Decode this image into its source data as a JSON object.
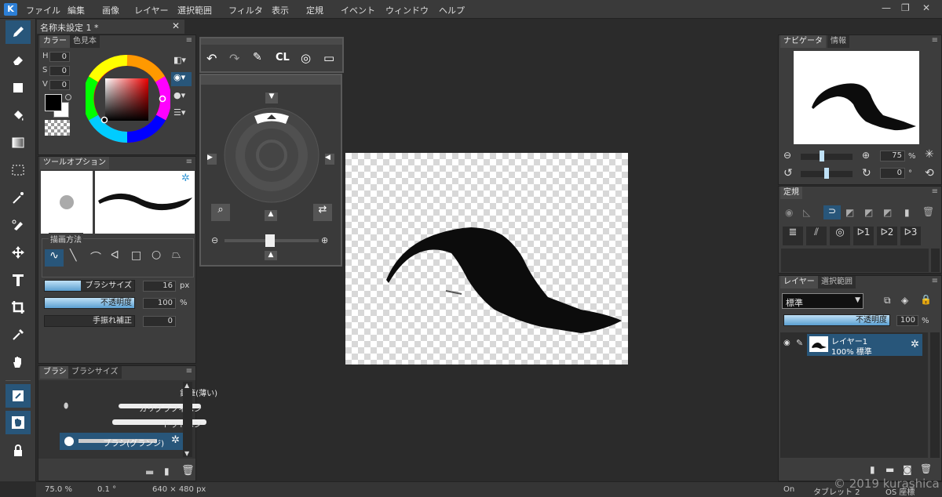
{
  "menubar": {
    "items": [
      "ファイル",
      "編集",
      "画像",
      "レイヤー",
      "選択範囲",
      "フィルタ",
      "表示",
      "定規",
      "イベント",
      "ウィンドウ",
      "ヘルプ"
    ]
  },
  "document_tab": {
    "title": "名称未設定 1 *"
  },
  "color_panel": {
    "tabs": [
      "カラー",
      "色見本"
    ],
    "h_label": "H",
    "s_label": "S",
    "v_label": "V",
    "h": "0",
    "s": "0",
    "v": "0",
    "foreground": "#000000",
    "background": "#ffffff"
  },
  "tool_options": {
    "tab": "ツールオプション",
    "draw_method_label": "描画方法",
    "brush_size_label": "ブラシサイズ",
    "brush_size": "16",
    "brush_size_unit": "px",
    "opacity_label": "不透明度",
    "opacity": "100",
    "opacity_unit": "%",
    "stabilizer_label": "手振れ補正",
    "stabilizer": "0"
  },
  "brush_panel": {
    "tabs": [
      "ブラシ",
      "ブラシサイズ"
    ],
    "items": [
      "鉛筆(薄い)",
      "カリグラフィペン",
      "ドットペン",
      "ブラシ(グランジ)"
    ],
    "selected": 3
  },
  "navigator": {
    "tabs": [
      "ナビゲータ",
      "情報"
    ],
    "zoom": "75",
    "zoom_unit": "%",
    "rotation": "0",
    "rotation_unit": "°"
  },
  "ruler_panel": {
    "tab": "定規"
  },
  "layer_panel": {
    "tabs": [
      "レイヤー",
      "選択範囲"
    ],
    "blend_mode": "標準",
    "opacity_label": "不透明度",
    "opacity": "100",
    "opacity_unit": "%",
    "layer_name": "レイヤー1",
    "layer_info": "100% 標準"
  },
  "float_toolbar": {
    "cl_label": "CL"
  },
  "status": {
    "zoom": "75.0 %",
    "rotation": "0.1 °",
    "size": "640 × 480 px",
    "on": "On",
    "tablet": "タブレット 2",
    "os": "OS 座標"
  },
  "watermark": "© 2019 kurashica",
  "colors": {
    "accent": "#2d7fd6",
    "selected": "#28567a",
    "panel": "#3d3d3d",
    "bg": "#2b2b2b"
  }
}
